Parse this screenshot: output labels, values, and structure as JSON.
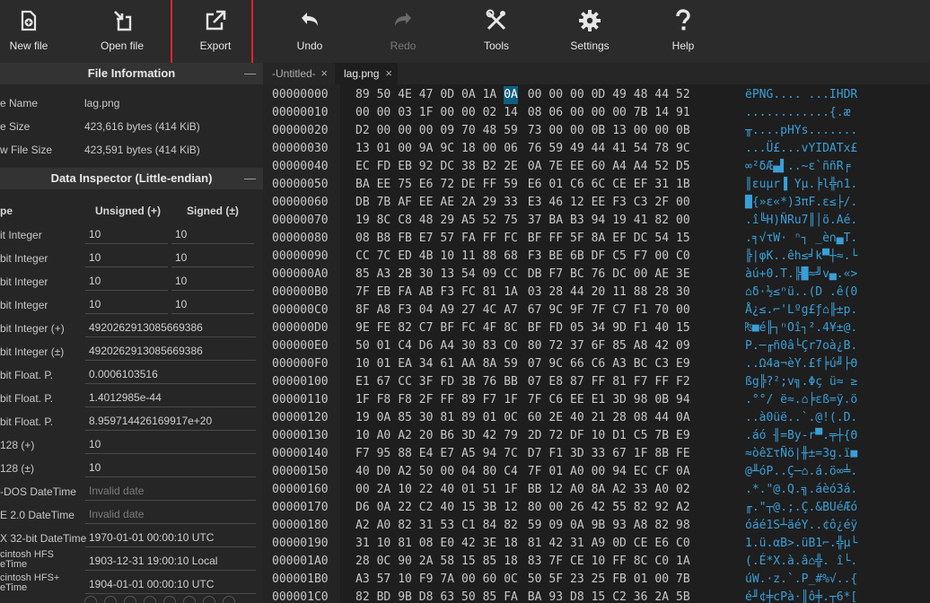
{
  "toolbar": {
    "items": [
      {
        "label": "New file",
        "icon": "new-file-icon"
      },
      {
        "label": "Open file",
        "icon": "open-file-icon"
      },
      {
        "label": "Export",
        "icon": "export-icon"
      },
      {
        "label": "Undo",
        "icon": "undo-icon"
      },
      {
        "label": "Redo",
        "icon": "redo-icon",
        "disabled": true
      },
      {
        "label": "Tools",
        "icon": "tools-icon"
      },
      {
        "label": "Settings",
        "icon": "gear-icon"
      },
      {
        "label": "Help",
        "icon": "help-icon"
      }
    ],
    "highlight_color": "#e0262a"
  },
  "file_info": {
    "title": "File Information",
    "rows": [
      {
        "key": "e Name",
        "value": "lag.png"
      },
      {
        "key": "e Size",
        "value": "423,616 bytes (414 KiB)"
      },
      {
        "key": "w File Size",
        "value": "423,591 bytes (414 KiB)"
      }
    ]
  },
  "inspector": {
    "title": "Data Inspector (Little-endian)",
    "col_type": "pe",
    "col_unsigned": "Unsigned (+)",
    "col_signed": "Signed (±)",
    "rows": [
      {
        "key": "it Integer",
        "unsigned": "10",
        "signed": "10"
      },
      {
        "key": "bit Integer",
        "unsigned": "10",
        "signed": "10"
      },
      {
        "key": "bit Integer",
        "unsigned": "10",
        "signed": "10"
      },
      {
        "key": "bit Integer",
        "unsigned": "10",
        "signed": "10"
      },
      {
        "key": "bit Integer (+)",
        "value": "4920262913085669386"
      },
      {
        "key": "bit Integer (±)",
        "value": "4920262913085669386"
      },
      {
        "key": "bit Float. P.",
        "value": "0.0006103516"
      },
      {
        "key": "bit Float. P.",
        "value": "1.4012985e-44"
      },
      {
        "key": "bit Float. P.",
        "value": "8.959714426169917e+20"
      },
      {
        "key": "128 (+)",
        "value": "10"
      },
      {
        "key": "128 (±)",
        "value": "10"
      },
      {
        "key": "-DOS DateTime",
        "value": "Invalid date",
        "placeholder": true
      },
      {
        "key": "E 2.0 DateTime",
        "value": "Invalid date",
        "placeholder": true
      },
      {
        "key": "X 32-bit DateTime",
        "value": "1970-01-01 00:00:10 UTC"
      },
      {
        "key_line1": "cintosh HFS",
        "key_line2": "eTime",
        "value": "1903-12-31 19:00:10 Local"
      },
      {
        "key_line1": "cintosh HFS+",
        "key_line2": "eTime",
        "value": "1904-01-01 00:00:10 UTC"
      }
    ]
  },
  "tabs": [
    {
      "label": "-Untitled-",
      "close": "×",
      "active": false
    },
    {
      "label": "lag.png",
      "close": "×",
      "active": true
    }
  ],
  "hex": {
    "selected_offset": "00000000",
    "selected_byte_index": 7,
    "rows": [
      {
        "offset": "00000000",
        "bytes": [
          "89",
          "50",
          "4E",
          "47",
          "0D",
          "0A",
          "1A",
          "0A",
          "00",
          "00",
          "00",
          "0D",
          "49",
          "48",
          "44",
          "52"
        ],
        "ascii": "ëPNG.... ...IHDR"
      },
      {
        "offset": "00000010",
        "bytes": [
          "00",
          "00",
          "03",
          "1F",
          "00",
          "00",
          "02",
          "14",
          "08",
          "06",
          "00",
          "00",
          "00",
          "7B",
          "14",
          "91"
        ],
        "ascii": "............{.æ"
      },
      {
        "offset": "00000020",
        "bytes": [
          "D2",
          "00",
          "00",
          "00",
          "09",
          "70",
          "48",
          "59",
          "73",
          "00",
          "00",
          "0B",
          "13",
          "00",
          "00",
          "0B"
        ],
        "ascii": "╥....pHYs......."
      },
      {
        "offset": "00000030",
        "bytes": [
          "13",
          "01",
          "00",
          "9A",
          "9C",
          "18",
          "00",
          "06",
          "76",
          "59",
          "49",
          "44",
          "41",
          "54",
          "78",
          "9C"
        ],
        "ascii": "...Ü£...vYIDATx£"
      },
      {
        "offset": "00000040",
        "bytes": [
          "EC",
          "FD",
          "EB",
          "92",
          "DC",
          "38",
          "B2",
          "2E",
          "0A",
          "7E",
          "EE",
          "60",
          "A4",
          "A4",
          "52",
          "D5"
        ],
        "ascii": "∞²δÆ▄▌..~ε`ññR╒"
      },
      {
        "offset": "00000050",
        "bytes": [
          "BA",
          "EE",
          "75",
          "E6",
          "72",
          "DE",
          "FF",
          "59",
          "E6",
          "01",
          "C6",
          "6C",
          "CE",
          "EF",
          "31",
          "1B"
        ],
        "ascii": "║εuµr▐ Yµ.╞l╬∩1."
      },
      {
        "offset": "00000060",
        "bytes": [
          "DB",
          "7B",
          "AF",
          "EE",
          "AE",
          "2A",
          "29",
          "33",
          "E3",
          "46",
          "12",
          "EE",
          "F3",
          "C3",
          "2F",
          "00"
        ],
        "ascii": "█{»ε«*)3πF.ε≤├/."
      },
      {
        "offset": "00000070",
        "bytes": [
          "19",
          "8C",
          "C8",
          "48",
          "29",
          "A5",
          "52",
          "75",
          "37",
          "BA",
          "B3",
          "94",
          "19",
          "41",
          "82",
          "00"
        ],
        "ascii": ".î╚H)ÑRu7║│ö.Aé."
      },
      {
        "offset": "00000080",
        "bytes": [
          "08",
          "B8",
          "FB",
          "E7",
          "57",
          "FA",
          "FF",
          "FC",
          "BF",
          "FF",
          "5F",
          "8A",
          "EF",
          "DC",
          "54",
          "15"
        ],
        "ascii": ".╕√τW· ⁿ┐ _è∩▄T."
      },
      {
        "offset": "00000090",
        "bytes": [
          "CC",
          "7C",
          "ED",
          "4B",
          "10",
          "11",
          "88",
          "68",
          "F3",
          "BE",
          "6B",
          "DF",
          "C5",
          "F7",
          "00",
          "C0"
        ],
        "ascii": "╠|φK..êh≤╛k▀┼≈.└"
      },
      {
        "offset": "000000A0",
        "bytes": [
          "85",
          "A3",
          "2B",
          "30",
          "13",
          "54",
          "09",
          "CC",
          "DB",
          "F7",
          "BC",
          "76",
          "DC",
          "00",
          "AE",
          "3E"
        ],
        "ascii": "àú+0.T.╠█≈╝v▄.«>"
      },
      {
        "offset": "000000B0",
        "bytes": [
          "7F",
          "EB",
          "FA",
          "AB",
          "F3",
          "FC",
          "81",
          "1A",
          "03",
          "28",
          "44",
          "20",
          "11",
          "88",
          "28",
          "30"
        ],
        "ascii": "⌂δ·½≤ⁿü..(D .ê(0"
      },
      {
        "offset": "000000C0",
        "bytes": [
          "8F",
          "A8",
          "F3",
          "04",
          "A9",
          "27",
          "4C",
          "A7",
          "67",
          "9C",
          "9F",
          "7F",
          "C7",
          "F1",
          "70",
          "00"
        ],
        "ascii": "Å¿≤.⌐'Lºg£ƒ⌂╟±p."
      },
      {
        "offset": "000000D0",
        "bytes": [
          "9E",
          "FE",
          "82",
          "C7",
          "BF",
          "FC",
          "4F",
          "8C",
          "BF",
          "FD",
          "05",
          "34",
          "9D",
          "F1",
          "40",
          "15"
        ],
        "ascii": "₧■é╟┐ⁿOî┐².4¥±@."
      },
      {
        "offset": "000000E0",
        "bytes": [
          "50",
          "01",
          "C4",
          "D6",
          "A4",
          "30",
          "83",
          "C0",
          "80",
          "72",
          "37",
          "6F",
          "85",
          "A8",
          "42",
          "09"
        ],
        "ascii": "P.─╓ñ0â└Çr7oà¿B."
      },
      {
        "offset": "000000F0",
        "bytes": [
          "10",
          "01",
          "EA",
          "34",
          "61",
          "AA",
          "8A",
          "59",
          "07",
          "9C",
          "66",
          "C6",
          "A3",
          "BC",
          "C3",
          "E9"
        ],
        "ascii": "..Ω4a¬èY.£f╞ú╝├Θ"
      },
      {
        "offset": "00000100",
        "bytes": [
          "E1",
          "67",
          "CC",
          "3F",
          "FD",
          "3B",
          "76",
          "BB",
          "07",
          "E8",
          "87",
          "FF",
          "81",
          "F7",
          "FF",
          "F2"
        ],
        "ascii": "ßg╠?²;v╗.Φç ü≈ ≥"
      },
      {
        "offset": "00000110",
        "bytes": [
          "1F",
          "F8",
          "F8",
          "2F",
          "FF",
          "89",
          "F7",
          "1F",
          "7F",
          "C6",
          "EE",
          "E1",
          "3D",
          "98",
          "0B",
          "94"
        ],
        "ascii": ".°°/ ë≈.⌂╞εß=ÿ.ö"
      },
      {
        "offset": "00000120",
        "bytes": [
          "19",
          "0A",
          "85",
          "30",
          "81",
          "89",
          "01",
          "0C",
          "60",
          "2E",
          "40",
          "21",
          "28",
          "08",
          "44",
          "0A"
        ],
        "ascii": "..à0üë..`.@!(.D."
      },
      {
        "offset": "00000130",
        "bytes": [
          "10",
          "A0",
          "A2",
          "20",
          "B6",
          "3D",
          "42",
          "79",
          "2D",
          "72",
          "DF",
          "10",
          "D1",
          "C5",
          "7B",
          "E9"
        ],
        "ascii": ".áó ╢=By-r▀.╤┼{Θ"
      },
      {
        "offset": "00000140",
        "bytes": [
          "F7",
          "95",
          "88",
          "E4",
          "E7",
          "A5",
          "94",
          "7C",
          "D7",
          "F1",
          "3D",
          "33",
          "67",
          "1F",
          "8B",
          "FE"
        ],
        "ascii": "≈òêΣτÑö|╫±=3g.ï■"
      },
      {
        "offset": "00000150",
        "bytes": [
          "40",
          "D0",
          "A2",
          "50",
          "00",
          "04",
          "80",
          "C4",
          "7F",
          "01",
          "A0",
          "00",
          "94",
          "EC",
          "CF",
          "0A"
        ],
        "ascii": "@╨óP..Ç─⌂.á.ö∞╧."
      },
      {
        "offset": "00000160",
        "bytes": [
          "00",
          "2A",
          "10",
          "22",
          "40",
          "01",
          "51",
          "1F",
          "BB",
          "12",
          "A0",
          "8A",
          "A2",
          "33",
          "A0",
          "02"
        ],
        "ascii": ".*.\"@.Q.╗.áèó3á."
      },
      {
        "offset": "00000170",
        "bytes": [
          "D6",
          "0A",
          "22",
          "C2",
          "40",
          "15",
          "3B",
          "12",
          "80",
          "00",
          "26",
          "42",
          "55",
          "82",
          "92",
          "A2"
        ],
        "ascii": "╓.\"┬@.;.Ç.&BUéÆó"
      },
      {
        "offset": "00000180",
        "bytes": [
          "A2",
          "A0",
          "82",
          "31",
          "53",
          "C1",
          "84",
          "82",
          "59",
          "09",
          "0A",
          "9B",
          "93",
          "A8",
          "82",
          "98"
        ],
        "ascii": "óáé1S┴äéY..¢ô¿éÿ"
      },
      {
        "offset": "00000190",
        "bytes": [
          "31",
          "10",
          "81",
          "08",
          "E0",
          "42",
          "3E",
          "18",
          "81",
          "42",
          "31",
          "A9",
          "0D",
          "CE",
          "E6",
          "C0"
        ],
        "ascii": "1.ü.αB>.üB1⌐.╬µ└"
      },
      {
        "offset": "000001A0",
        "bytes": [
          "28",
          "0C",
          "90",
          "2A",
          "58",
          "15",
          "85",
          "18",
          "83",
          "7F",
          "CE",
          "10",
          "FF",
          "8C",
          "C0",
          "1A"
        ],
        "ascii": "(.É*X.à.â⌂╬. î└."
      },
      {
        "offset": "000001B0",
        "bytes": [
          "A3",
          "57",
          "10",
          "F9",
          "7A",
          "00",
          "60",
          "0C",
          "50",
          "5F",
          "23",
          "25",
          "FB",
          "01",
          "00",
          "7B"
        ],
        "ascii": "úW.·z.`.P_#%√..{"
      },
      {
        "offset": "000001C0",
        "bytes": [
          "82",
          "BD",
          "9B",
          "D8",
          "63",
          "50",
          "85",
          "FA",
          "BA",
          "93",
          "D8",
          "15",
          "C2",
          "36",
          "2A",
          "5B"
        ],
        "ascii": "é╜¢╪cPà·║ô╪.┬6*["
      }
    ]
  }
}
